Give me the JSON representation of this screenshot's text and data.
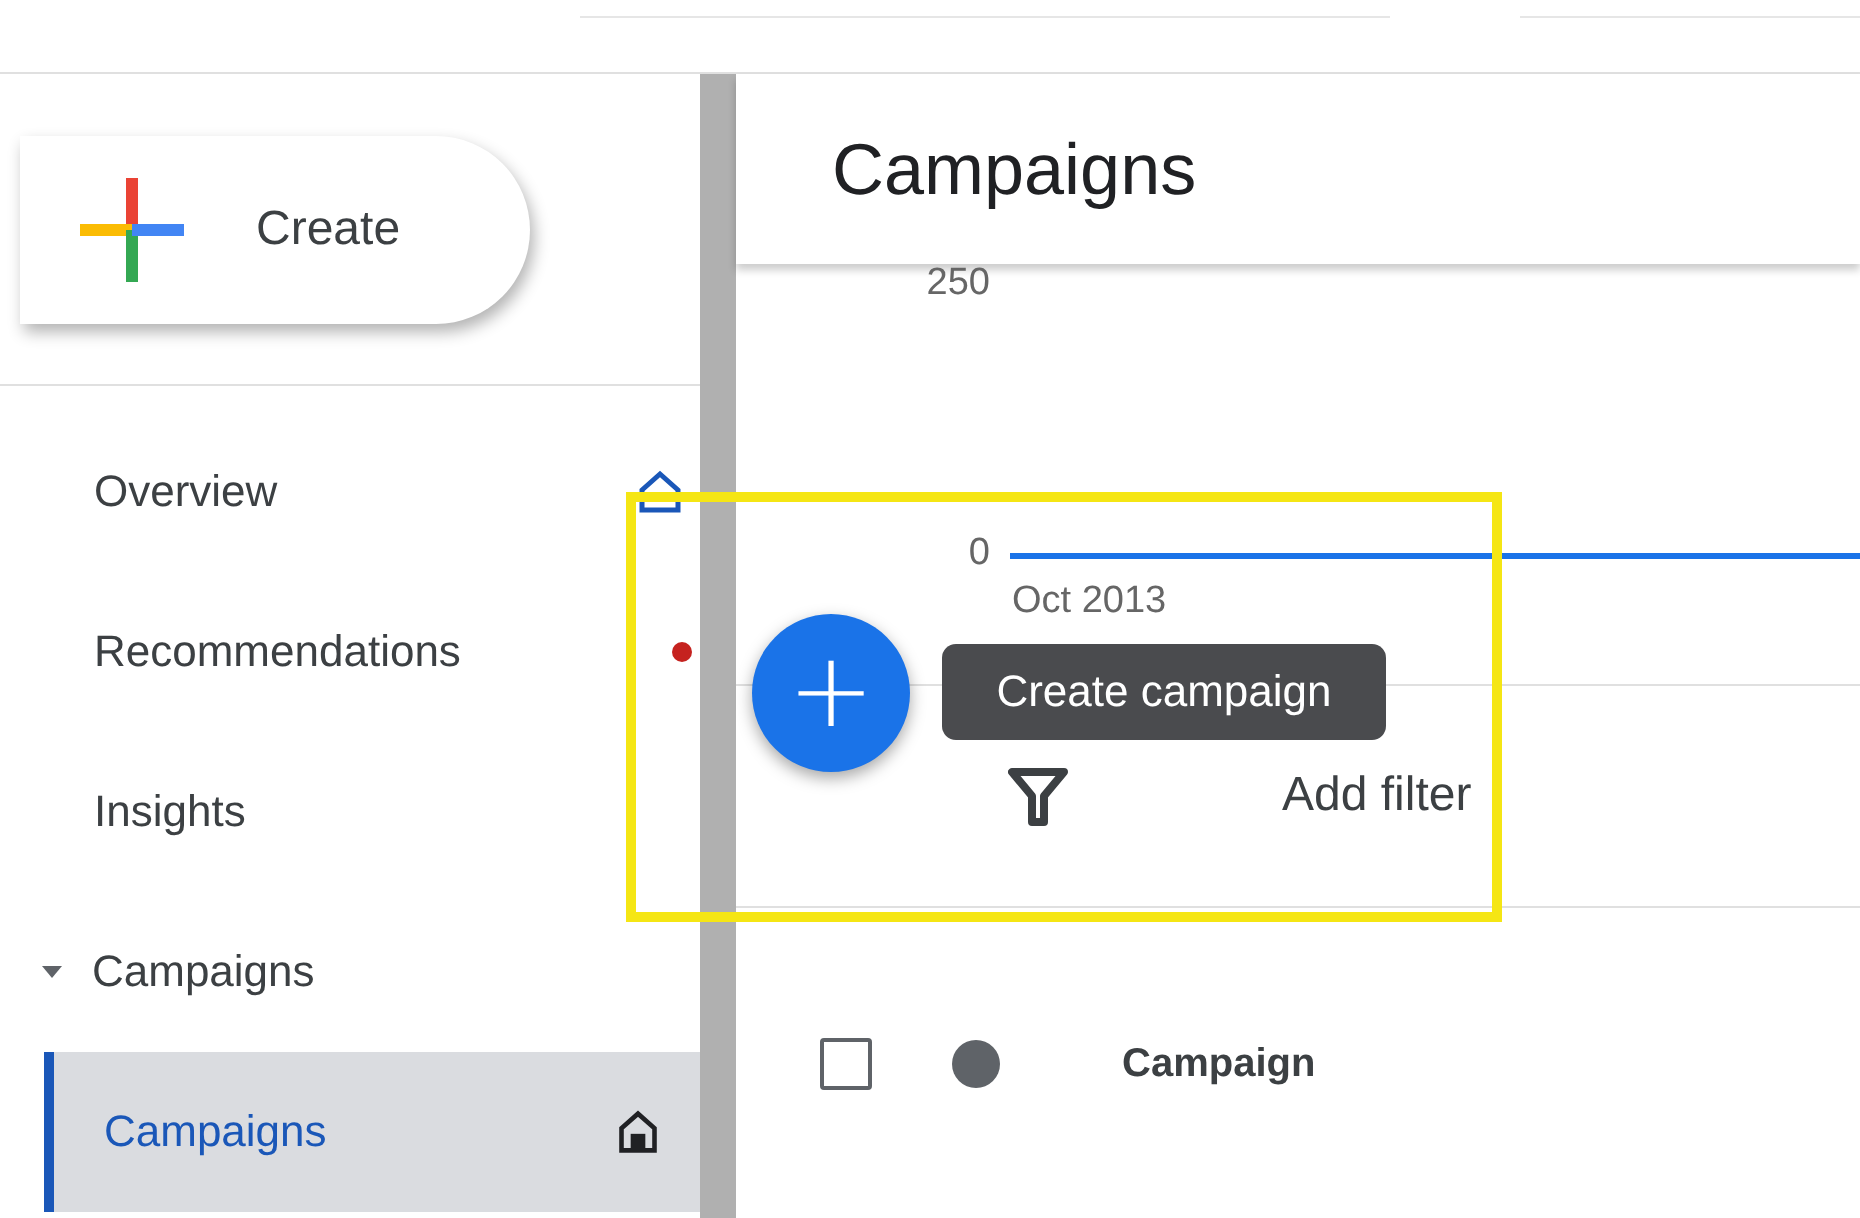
{
  "sidebar": {
    "create_button": {
      "label": "Create"
    },
    "items": [
      {
        "label": "Overview",
        "kind": "home",
        "selected": false
      },
      {
        "label": "Recommendations",
        "kind": "alert",
        "selected": false
      },
      {
        "label": "Insights",
        "kind": "plain",
        "selected": false
      },
      {
        "label": "Campaigns",
        "kind": "group",
        "expanded": true,
        "selected": false
      },
      {
        "label": "Campaigns",
        "kind": "home",
        "selected": true
      }
    ]
  },
  "main": {
    "title": "Campaigns",
    "chart": {
      "y_ticks": [
        "250",
        "0"
      ],
      "x_label": "Oct 2013"
    },
    "fab": {
      "label": "+"
    },
    "tooltip": "Create campaign",
    "filter": {
      "label": "Add filter"
    },
    "table": {
      "columns": [
        {
          "kind": "checkbox",
          "checked": false
        },
        {
          "kind": "status"
        },
        {
          "kind": "text",
          "label": "Campaign"
        }
      ]
    }
  },
  "highlight": {
    "kind": "frame"
  }
}
